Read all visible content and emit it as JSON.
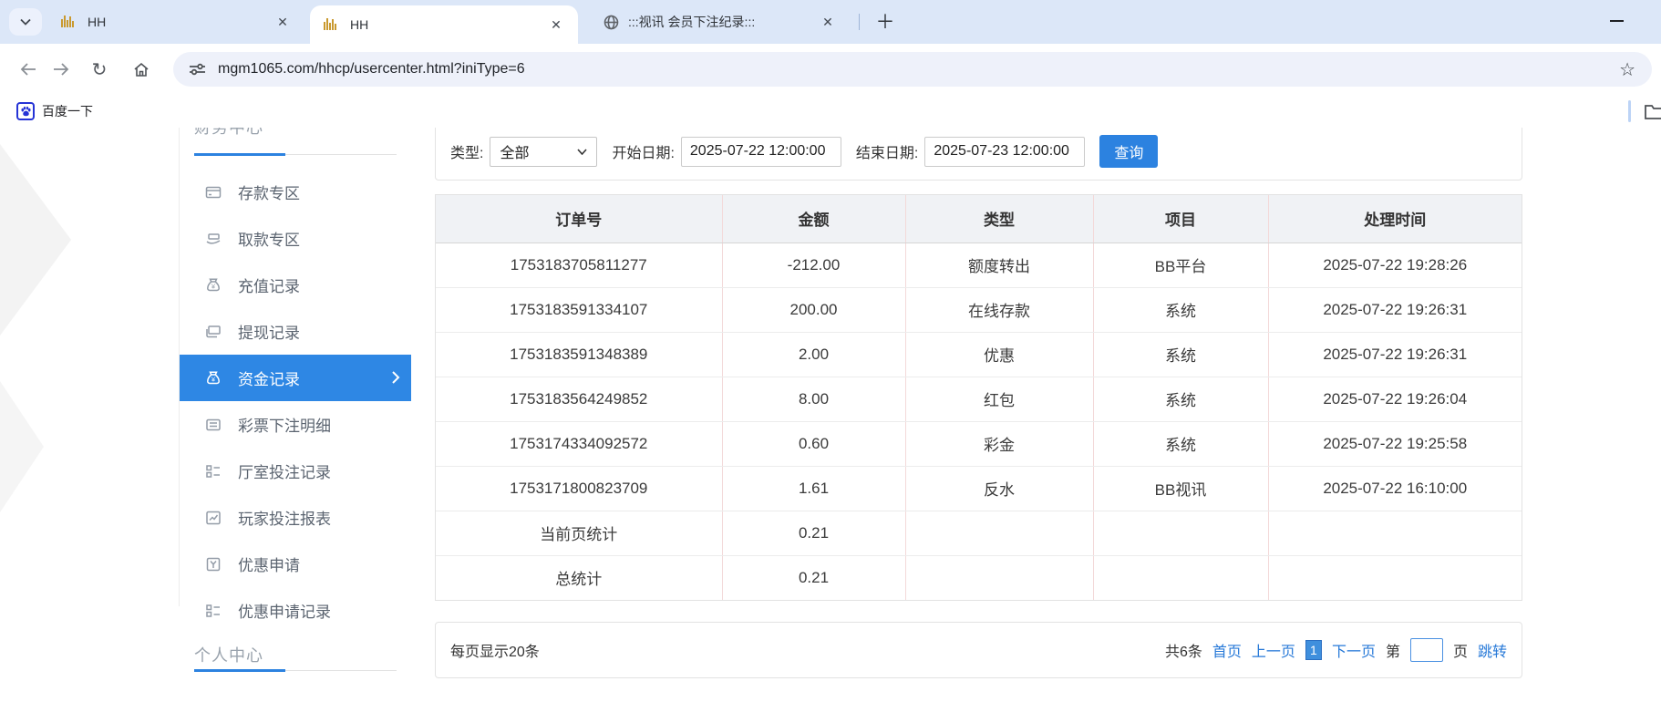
{
  "browser": {
    "tabs": [
      {
        "label": "HH"
      },
      {
        "label": "HH"
      },
      {
        "label": ":::视讯 会员下注纪录:::"
      }
    ],
    "url": "mgm1065.com/hhcp/usercenter.html?iniType=6",
    "bookmark": "百度一下"
  },
  "sidebar": {
    "top_section": "财务中心",
    "bottom_section": "个人中心",
    "items": [
      {
        "label": "存款专区",
        "icon": "credit-card-icon"
      },
      {
        "label": "取款专区",
        "icon": "hand-money-icon"
      },
      {
        "label": "充值记录",
        "icon": "money-bag-icon"
      },
      {
        "label": "提现记录",
        "icon": "cash-cards-icon"
      },
      {
        "label": "资金记录",
        "icon": "fund-bag-icon",
        "active": true
      },
      {
        "label": "彩票下注明细",
        "icon": "list-doc-icon"
      },
      {
        "label": "厅室投注记录",
        "icon": "grid-list-icon"
      },
      {
        "label": "玩家投注报表",
        "icon": "chart-report-icon"
      },
      {
        "label": "优惠申请",
        "icon": "promo-apply-icon"
      },
      {
        "label": "优惠申请记录",
        "icon": "grid-list-icon"
      }
    ]
  },
  "filters": {
    "type_label": "类型:",
    "type_value": "全部",
    "start_label": "开始日期:",
    "start_value": "2025-07-22 12:00:00",
    "end_label": "结束日期:",
    "end_value": "2025-07-23 12:00:00",
    "search_button": "查询"
  },
  "table": {
    "columns": [
      "订单号",
      "金额",
      "类型",
      "项目",
      "处理时间"
    ],
    "rows": [
      [
        "1753183705811277",
        "-212.00",
        "额度转出",
        "BB平台",
        "2025-07-22 19:28:26"
      ],
      [
        "1753183591334107",
        "200.00",
        "在线存款",
        "系统",
        "2025-07-22 19:26:31"
      ],
      [
        "1753183591348389",
        "2.00",
        "优惠",
        "系统",
        "2025-07-22 19:26:31"
      ],
      [
        "1753183564249852",
        "8.00",
        "红包",
        "系统",
        "2025-07-22 19:26:04"
      ],
      [
        "1753174334092572",
        "0.60",
        "彩金",
        "系统",
        "2025-07-22 19:25:58"
      ],
      [
        "1753171800823709",
        "1.61",
        "反水",
        "BB视讯",
        "2025-07-22 16:10:00"
      ],
      [
        "当前页统计",
        "0.21",
        "",
        "",
        ""
      ],
      [
        "总统计",
        "0.21",
        "",
        "",
        ""
      ]
    ]
  },
  "pagination": {
    "page_size": "每页显示20条",
    "total": "共6条",
    "first": "首页",
    "prev": "上一页",
    "current": "1",
    "next": "下一页",
    "jump_pre": "第",
    "jump_post": "页",
    "jump": "跳转"
  },
  "colors": {
    "accent": "#2c82e0",
    "link": "#2779d8",
    "active_item_bg": "#2e87e4",
    "tabbar_bg": "#dce7f8",
    "table_header_bg": "#f0f2f5",
    "table_vline": "#f3d9d9"
  }
}
